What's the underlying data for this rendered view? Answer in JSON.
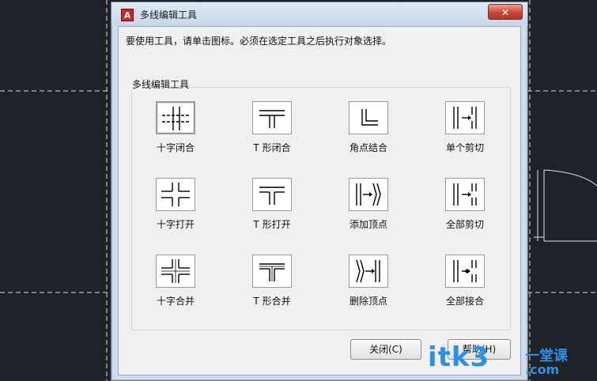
{
  "window": {
    "title": "多线编辑工具",
    "close_label": "✕",
    "app_icon_glyph": "A"
  },
  "instruction": "要使用工具，请单击图标。必须在选定工具之后执行对象选择。",
  "group_label": "多线编辑工具",
  "tools": [
    {
      "label": "十字闭合",
      "icon": "cross-closed-icon"
    },
    {
      "label": "T 形闭合",
      "icon": "tee-closed-icon"
    },
    {
      "label": "角点结合",
      "icon": "corner-joint-icon"
    },
    {
      "label": "单个剪切",
      "icon": "cut-single-icon"
    },
    {
      "label": "十字打开",
      "icon": "cross-open-icon"
    },
    {
      "label": "T 形打开",
      "icon": "tee-open-icon"
    },
    {
      "label": "添加顶点",
      "icon": "add-vertex-icon"
    },
    {
      "label": "全部剪切",
      "icon": "cut-all-icon"
    },
    {
      "label": "十字合并",
      "icon": "cross-merged-icon"
    },
    {
      "label": "T 形合并",
      "icon": "tee-merged-icon"
    },
    {
      "label": "删除顶点",
      "icon": "delete-vertex-icon"
    },
    {
      "label": "全部接合",
      "icon": "weld-all-icon"
    }
  ],
  "buttons": {
    "close": "关闭(C)",
    "help": "帮助(H)"
  },
  "watermark": {
    "main": "itk3",
    "cn": "一堂课",
    "com": ".com"
  },
  "colors": {
    "close_red": "#c8463a",
    "watermark_blue": "#2f8fe0",
    "cad_bg": "#1f2329"
  }
}
